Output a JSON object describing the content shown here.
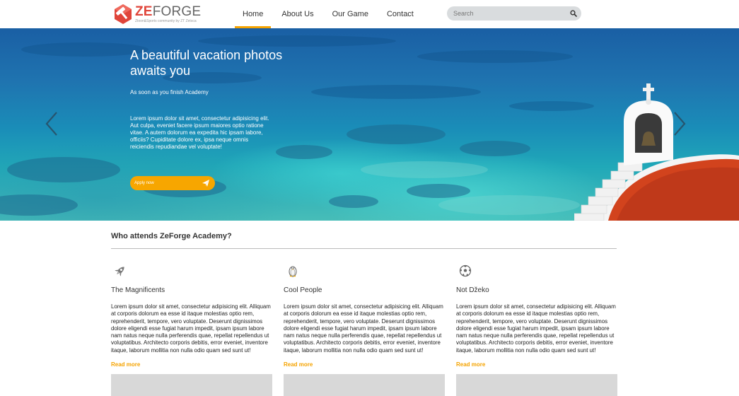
{
  "header": {
    "logo": {
      "word_a": "ZE",
      "word_b": "FORGE",
      "tagline": "Ztoon&Sports community by ZT Zetsca",
      "accent": "#e0453a"
    },
    "nav": [
      {
        "label": "Home",
        "active": true
      },
      {
        "label": "About Us",
        "active": false
      },
      {
        "label": "Our Game",
        "active": false
      },
      {
        "label": "Contact",
        "active": false
      }
    ],
    "search": {
      "placeholder": "Search",
      "value": "",
      "icon": "search-icon"
    }
  },
  "hero": {
    "title": "A beautiful vacation photos awaits you",
    "subtitle": "As soon as you finish Academy",
    "body": "Lorem ipsum dolor sit amet, consectetur adipisicing elit. Aut culpa, eveniet facere ipsum maiores optio ratione vitae. A autem dolorum ea expedita hic ipsam labore, officiis? Cupiditate dolore ex, ipsa neque omnis reiciendis repudiandae vel voluptate!",
    "cta_label": "Apply now",
    "cta_icon": "paper-plane-icon",
    "prev_icon": "chevron-left-icon",
    "next_icon": "chevron-right-icon",
    "accent": "#f7a600"
  },
  "section": {
    "title": "Who attends ZeForge Academy?",
    "cards": [
      {
        "icon": "rocket-icon",
        "title": "The Magnificents",
        "body": "Lorem ipsum dolor sit amet, consectetur adipisicing elit. Alliquam at corporis dolorum ea esse id itaque molestias optio rem, reprehenderit, tempore, vero voluptate. Deserunt dignissimos dolore eligendi esse fugiat harum impedit, ipsam ipsum labore nam natus neque nulla perferendis quae, repellat repellendus ut voluptatibus. Architecto corporis debitis, error eveniet, inventore itaque, laborum mollitia non nulla odio quam sed sunt ut!",
        "read_more": "Read more"
      },
      {
        "icon": "penguin-icon",
        "title": "Cool People",
        "body": "Lorem ipsum dolor sit amet, consectetur adipisicing elit. Alliquam at corporis dolorum ea esse id itaque molestias optio rem, reprehenderit, tempore, vero voluptate. Deserunt dignissimos dolore eligendi esse fugiat harum impedit, ipsam ipsum labore nam natus neque nulla perferendis quae, repellat repellendus ut voluptatibus. Architecto corporis debitis, error eveniet, inventore itaque, laborum mollitia non nulla odio quam sed sunt ut!",
        "read_more": "Read more"
      },
      {
        "icon": "soccer-ball-icon",
        "title": "Not Džeko",
        "body": "Lorem ipsum dolor sit amet, consectetur adipisicing elit. Alliquam at corporis dolorum ea esse id itaque molestias optio rem, reprehenderit, tempore, vero voluptate. Deserunt dignissimos dolore eligendi esse fugiat harum impedit, ipsam ipsum labore nam natus neque nulla perferendis quae, repellat repellendus ut voluptatibus. Architecto corporis debitis, error eveniet, inventore itaque, laborum mollitia non nulla odio quam sed sunt ut!",
        "read_more": "Read more"
      }
    ]
  },
  "colors": {
    "nav_active": "#f5a300",
    "link": "#f5a300",
    "search_bg": "#d9dcde"
  }
}
